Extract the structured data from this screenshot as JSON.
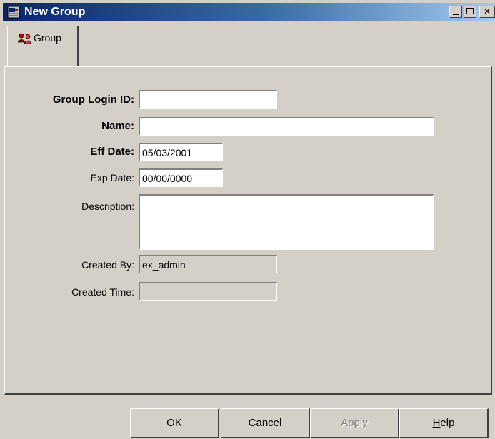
{
  "window": {
    "title": "New Group",
    "controls": {
      "minimize": "_",
      "maximize": "□",
      "close": "✕"
    }
  },
  "tabs": [
    {
      "label": "Group",
      "icon": "group-users-icon",
      "selected": true
    }
  ],
  "form": {
    "group_login_id": {
      "label": "Group Login ID:",
      "value": ""
    },
    "name": {
      "label": "Name:",
      "value": ""
    },
    "eff_date": {
      "label": "Eff Date:",
      "value": "05/03/2001"
    },
    "exp_date": {
      "label": "Exp Date:",
      "value": "00/00/0000"
    },
    "description": {
      "label": "Description:",
      "value": ""
    },
    "created_by": {
      "label": "Created By:",
      "value": "ex_admin"
    },
    "created_time": {
      "label": "Created Time:",
      "value": ""
    }
  },
  "buttons": {
    "ok": "OK",
    "cancel": "Cancel",
    "apply": "Apply",
    "help_first": "H",
    "help_rest": "elp"
  },
  "colors": {
    "face": "#d4d0c8",
    "titlebar_start": "#0a246a",
    "titlebar_end": "#a6caf0"
  }
}
